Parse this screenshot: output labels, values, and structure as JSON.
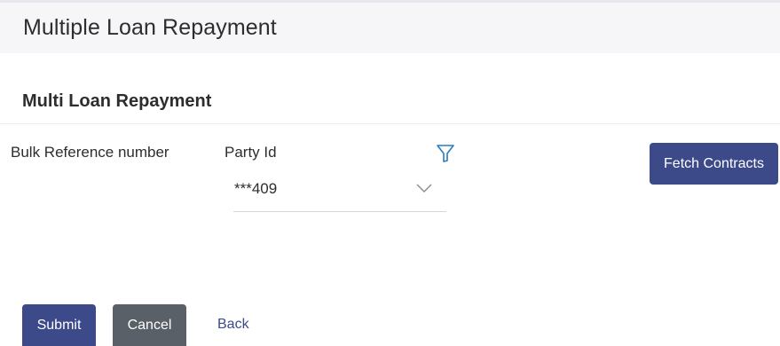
{
  "header": {
    "title": "Multiple Loan Repayment"
  },
  "section": {
    "title": "Multi Loan Repayment"
  },
  "form": {
    "bulk_reference_label": "Bulk Reference number",
    "party_id_label": "Party Id",
    "party_id_value": "***409",
    "filter_icon": "filter-icon",
    "dropdown_icon": "chevron-down-icon"
  },
  "actions": {
    "fetch_contracts_label": "Fetch Contracts",
    "submit_label": "Submit",
    "cancel_label": "Cancel",
    "back_label": "Back"
  },
  "colors": {
    "primary": "#3d4a8a",
    "secondary": "#5a6068",
    "filter_icon": "#2a7bbf",
    "header_background": "#f6f6f8"
  }
}
